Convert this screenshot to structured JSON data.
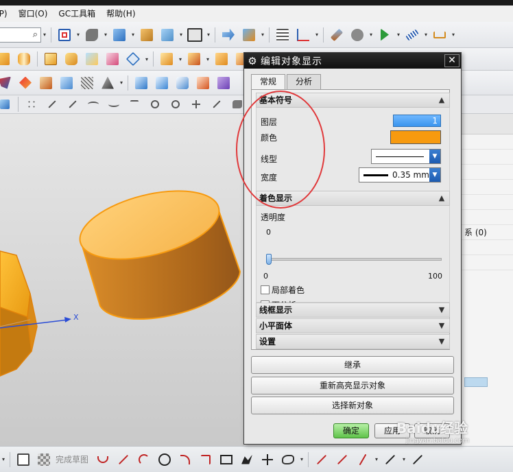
{
  "menubar": {
    "items": [
      "(P)",
      "窗口(O)",
      "GC工具箱",
      "帮助(H)"
    ]
  },
  "bottom_toolbar": {
    "finish_sketch": "完成草图"
  },
  "graphics": {
    "axis_label": "X"
  },
  "right_panel": {
    "row_text": "系 (0)"
  },
  "dialog": {
    "title": "编辑对象显示",
    "tabs": [
      "常规",
      "分析"
    ],
    "basic": {
      "header": "基本符号",
      "layer_label": "图层",
      "layer_value": "1",
      "color_label": "颜色",
      "color_value": "#f79a0f",
      "linetype_label": "线型",
      "width_label": "宽度",
      "width_value": "0.35 mm"
    },
    "shading": {
      "header": "着色显示",
      "transparency_label": "透明度",
      "transparency_value": "0",
      "slider_min": "0",
      "slider_max": "100",
      "partial_shading_label": "局部着色",
      "face_analysis_label": "面分析"
    },
    "collapsed_groups": [
      "线框显示",
      "小平面体",
      "设置"
    ],
    "wide_buttons": [
      "继承",
      "重新高亮显示对象",
      "选择新对象"
    ],
    "ok_label": "确定",
    "apply_label": "应用",
    "cancel_label": "取消"
  },
  "watermark": {
    "main": "Baidu经验",
    "sub": "jingyan.baidu.com"
  },
  "colors": {
    "accent_orange": "#f79a0f",
    "layer_blue": "#3a95ee",
    "ok_green": "#5fc34a",
    "highlight_red": "#e0383a"
  }
}
